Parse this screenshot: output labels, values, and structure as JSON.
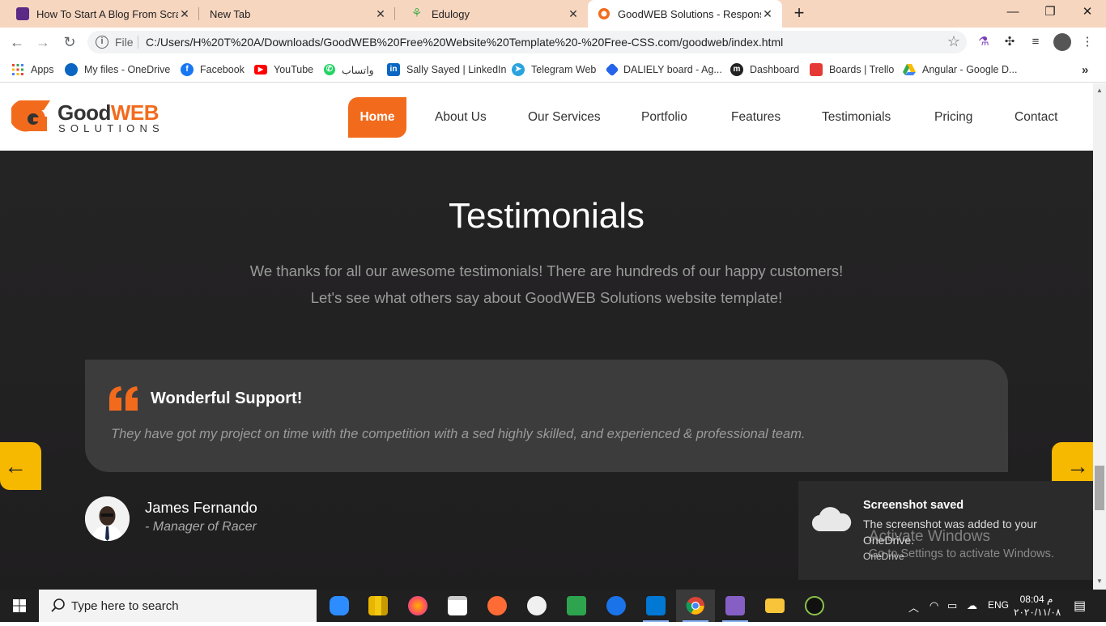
{
  "browser": {
    "tabs": [
      {
        "title": "How To Start A Blog From Scratch",
        "favicon_color": "#5b2a86"
      },
      {
        "title": "New Tab",
        "favicon_color": ""
      },
      {
        "title": "Edulogy",
        "favicon_color": "#4caf50"
      },
      {
        "title": "GoodWEB Solutions - Responsive",
        "favicon_color": "#f26b1d"
      }
    ],
    "close_glyph": "✕",
    "new_tab_glyph": "+",
    "window_buttons": {
      "minimize": "—",
      "restore": "❐",
      "close": "✕"
    },
    "address": {
      "scheme_label": "File",
      "url": "C:/Users/H%20T%20A/Downloads/GoodWEB%20Free%20Website%20Template%20-%20Free-CSS.com/goodweb/index.html"
    },
    "bookmarks": [
      {
        "label": "Apps",
        "icon": "apps-grid-icon",
        "color": "#e8453c"
      },
      {
        "label": "My files - OneDrive",
        "icon": "onedrive-icon",
        "color": "#0a66c2"
      },
      {
        "label": "Facebook",
        "icon": "facebook-icon",
        "color": "#1877f2"
      },
      {
        "label": "YouTube",
        "icon": "youtube-icon",
        "color": "#ff0000"
      },
      {
        "label": "واتساب",
        "icon": "whatsapp-icon",
        "color": "#25d366"
      },
      {
        "label": "Sally Sayed | LinkedIn",
        "icon": "linkedin-icon",
        "color": "#0a66c2"
      },
      {
        "label": "Telegram Web",
        "icon": "telegram-icon",
        "color": "#2aa3df"
      },
      {
        "label": "DALIELY board - Ag...",
        "icon": "board-icon",
        "color": "#2563eb"
      },
      {
        "label": "Dashboard",
        "icon": "dashboard-icon",
        "color": "#222222"
      },
      {
        "label": "Boards | Trello",
        "icon": "trello-icon",
        "color": "#e53935"
      },
      {
        "label": "Angular - Google D...",
        "icon": "google-drive-icon",
        "color": "#f4b400"
      }
    ],
    "bookmarks_overflow": "»"
  },
  "site": {
    "logo": {
      "good": "Good",
      "web": "WEB",
      "solutions": "SOLUTIONS"
    },
    "nav": [
      "Home",
      "About Us",
      "Our Services",
      "Portfolio",
      "Features",
      "Testimonials",
      "Pricing",
      "Contact"
    ],
    "testimonials": {
      "title": "Testimonials",
      "subtitle_1": "We thanks for all our awesome testimonials! There are hundreds of our happy customers!",
      "subtitle_2": "Let's see what others say about GoodWEB Solutions website template!",
      "card": {
        "title": "Wonderful Support!",
        "text": "They have got my project on time with the competition with a sed highly skilled, and experienced & professional team."
      },
      "person": {
        "name": "James Fernando",
        "role": "- Manager of Racer"
      },
      "prev_arrow": "←",
      "next_arrow": "→"
    },
    "accent": "#f26b1d",
    "arrow_color": "#f7b800"
  },
  "toast": {
    "title": "Screenshot saved",
    "body": "The screenshot was added to your OneDrive.",
    "source": "OneDrive"
  },
  "watermark": {
    "line1": "Activate Windows",
    "line2": "Go to Settings to activate Windows."
  },
  "taskbar": {
    "search_placeholder": "Type here to search",
    "language": "ENG",
    "time": "08:04 م",
    "date": "٢٠٢٠/١١/٠٨"
  }
}
